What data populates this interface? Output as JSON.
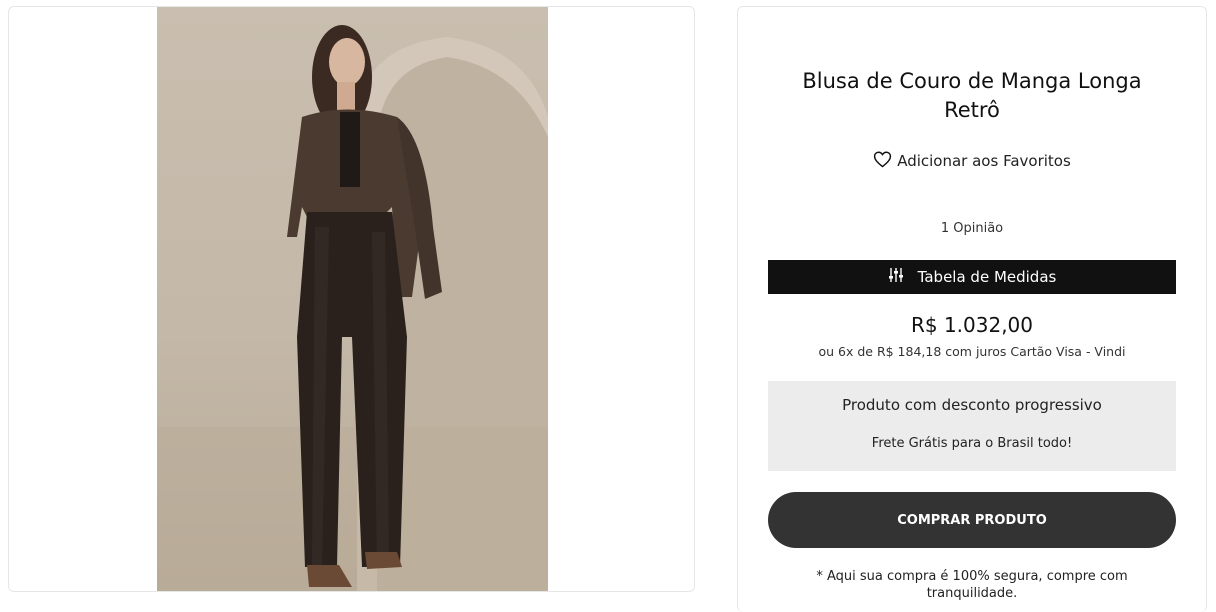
{
  "product": {
    "title_line1": "Blusa de Couro de Manga Longa",
    "title_line2": "Retrô",
    "favorite_label": "Adicionar aos Favoritos",
    "reviews_label": "1 Opinião",
    "size_table_label": "Tabela de Medidas",
    "price": "R$ 1.032,00",
    "installments": "ou 6x de R$ 184,18 com juros Cartão Visa - Vindi",
    "promo_title": "Produto com desconto progressivo",
    "promo_subtitle": "Frete Grátis para o Brasil todo!",
    "buy_label": "COMPRAR PRODUTO",
    "secure_note": "* Aqui sua compra é 100% segura, compre com tranquilidade."
  },
  "icons": {
    "favorite": "heart-icon",
    "size_table": "sliders-icon"
  },
  "colors": {
    "size_table_bg": "#111111",
    "buy_button_bg": "#333333",
    "promo_bg": "#ececec"
  }
}
